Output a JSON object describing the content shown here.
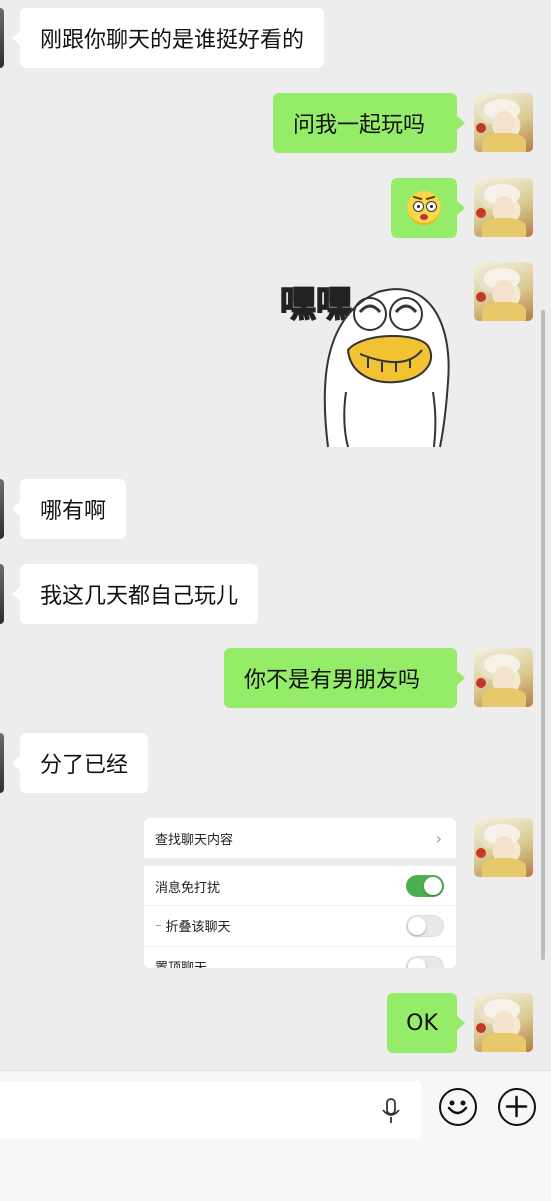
{
  "messages": [
    {
      "side": "left",
      "text": "刚跟你聊天的是谁挺好看的"
    },
    {
      "side": "right",
      "text": "问我一起玩吗"
    },
    {
      "side": "right",
      "type": "emoji-sticker",
      "sticker": "dizzy-face-emoji"
    },
    {
      "side": "right",
      "type": "image-sticker",
      "sticker": "duck-laughing-sticker",
      "caption": "嘿嘿"
    },
    {
      "side": "left",
      "text": "哪有啊"
    },
    {
      "side": "left",
      "text": "我这几天都自己玩儿"
    },
    {
      "side": "right",
      "text": "你不是有男朋友吗"
    },
    {
      "side": "left",
      "text": "分了已经"
    },
    {
      "side": "right",
      "type": "screenshot",
      "settings": {
        "search_label": "查找聊天内容",
        "items": [
          {
            "label": "消息免打扰",
            "toggle": "on"
          },
          {
            "label": "折叠该聊天",
            "toggle": "off"
          },
          {
            "label": "置顶聊天",
            "toggle": "off"
          }
        ]
      }
    },
    {
      "side": "right",
      "text": "OK"
    }
  ],
  "input_bar": {
    "placeholder": "",
    "voice_icon": "microphone-icon",
    "emoji_icon": "smiley-icon",
    "plus_icon": "plus-icon"
  },
  "colors": {
    "background": "#ededed",
    "sent_bubble": "#95ec69",
    "received_bubble": "#ffffff",
    "toggle_on": "#4caf50"
  }
}
